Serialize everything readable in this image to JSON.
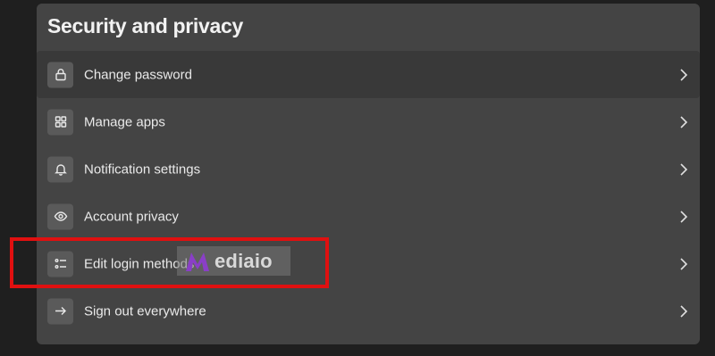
{
  "panel": {
    "title": "Security and privacy"
  },
  "menu": {
    "items": [
      {
        "label": "Change password",
        "icon": "lock-icon",
        "active": true
      },
      {
        "label": "Manage apps",
        "icon": "apps-grid-icon",
        "active": false
      },
      {
        "label": "Notification settings",
        "icon": "bell-icon",
        "active": false
      },
      {
        "label": "Account privacy",
        "icon": "eye-icon",
        "active": false
      },
      {
        "label": "Edit login methods",
        "icon": "list-checklist-icon",
        "active": false
      },
      {
        "label": "Sign out everywhere",
        "icon": "arrow-right-icon",
        "active": false
      }
    ]
  },
  "watermark": {
    "text": "ediaio"
  },
  "colors": {
    "background": "#1f1f1f",
    "panel": "#444444",
    "active_row": "#393939",
    "icon_box": "#5a5a5a",
    "highlight": "#e01010",
    "watermark_logo": "#8a3fc7"
  }
}
